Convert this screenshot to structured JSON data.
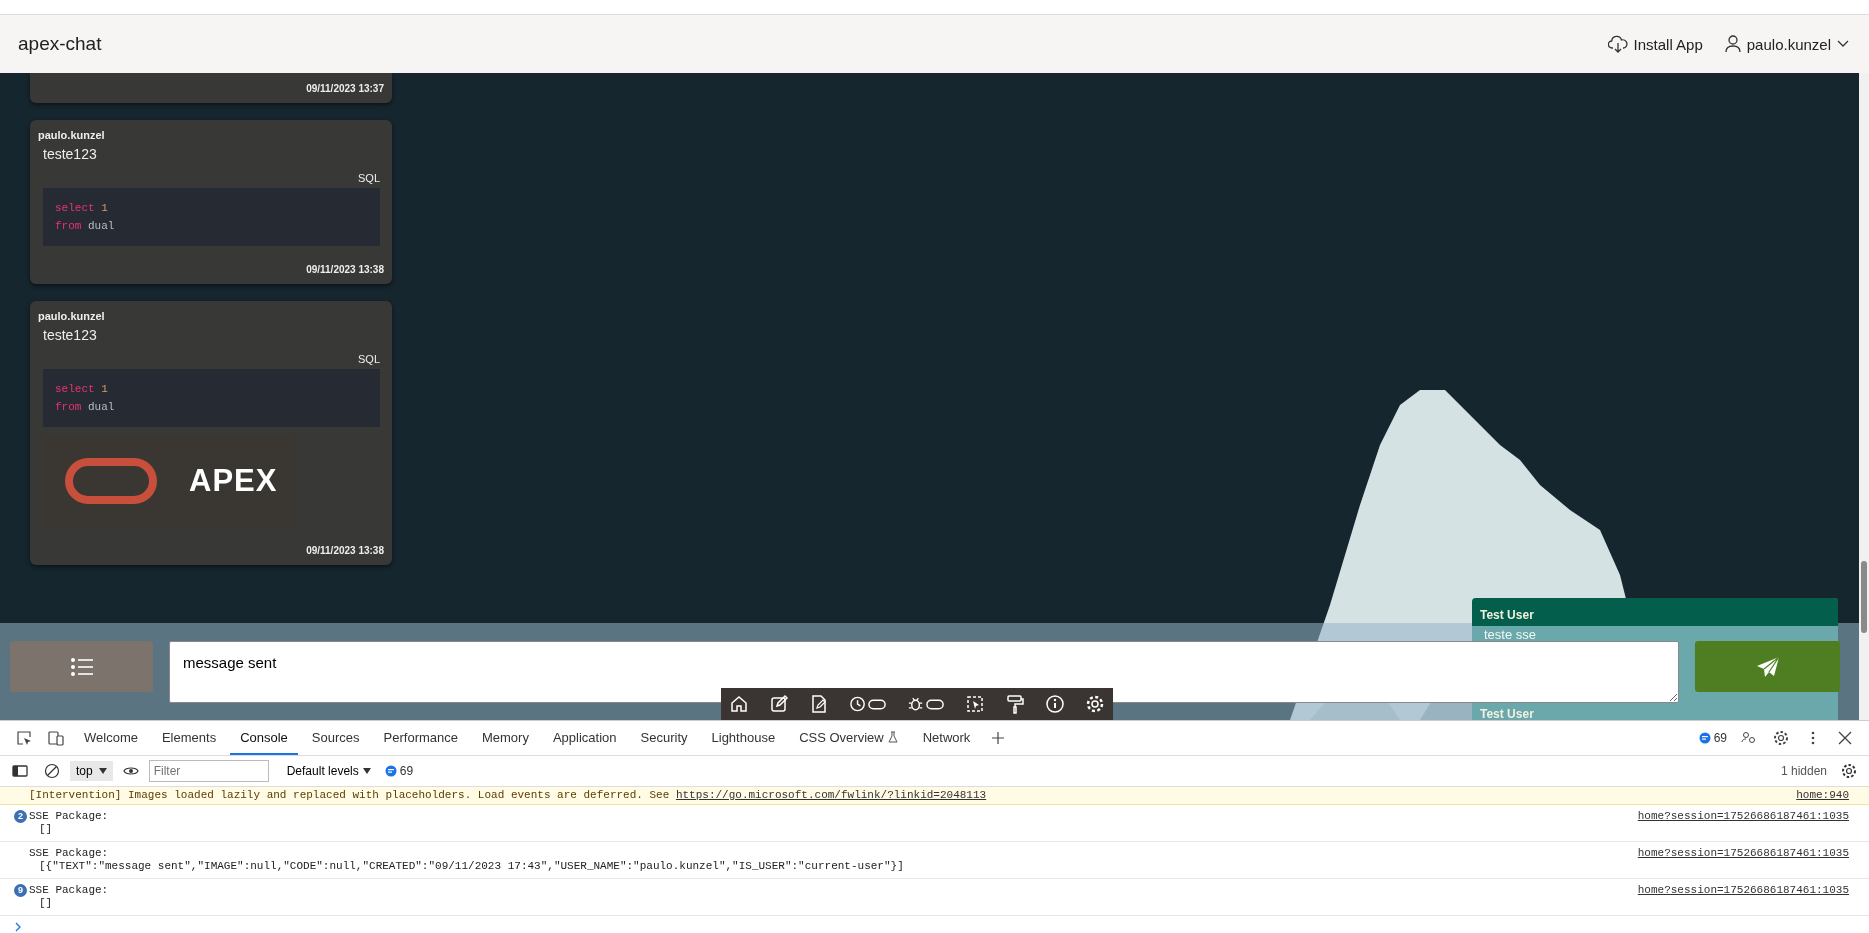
{
  "header": {
    "title": "apex-chat",
    "install_label": "Install App",
    "user": "paulo.kunzel"
  },
  "messages": [
    {
      "created": "09/11/2023 13:37"
    },
    {
      "user": "paulo.kunzel",
      "text": "teste123",
      "code": {
        "language": "SQL",
        "lines": [
          [
            {
              "kind": "keyword",
              "text": "select"
            },
            {
              "kind": "number",
              "text": "1"
            }
          ],
          [
            {
              "kind": "keyword",
              "text": "from"
            },
            {
              "kind": "plain",
              "text": "dual"
            }
          ]
        ]
      },
      "created": "09/11/2023 13:38"
    },
    {
      "user": "paulo.kunzel",
      "text": "teste123",
      "code": {
        "language": "SQL",
        "lines": [
          [
            {
              "kind": "keyword",
              "text": "select"
            },
            {
              "kind": "number",
              "text": "1"
            }
          ],
          [
            {
              "kind": "keyword",
              "text": "from"
            },
            {
              "kind": "plain",
              "text": "dual"
            }
          ]
        ]
      },
      "image": {
        "kind": "logo",
        "text": "APEX"
      },
      "created": "09/11/2023 13:38"
    }
  ],
  "incoming": [
    {
      "user": "Test User",
      "text": "teste sse"
    },
    {
      "user": "Test User"
    }
  ],
  "composer": {
    "value": "message sent"
  },
  "devtools": {
    "tabs": [
      {
        "label": "Welcome",
        "selected": false
      },
      {
        "label": "Elements",
        "selected": false
      },
      {
        "label": "Console",
        "selected": true
      },
      {
        "label": "Sources",
        "selected": false
      },
      {
        "label": "Performance",
        "selected": false
      },
      {
        "label": "Memory",
        "selected": false
      },
      {
        "label": "Application",
        "selected": false
      },
      {
        "label": "Security",
        "selected": false
      },
      {
        "label": "Lighthouse",
        "selected": false
      },
      {
        "label": "CSS Overview",
        "selected": false,
        "experimental": true
      },
      {
        "label": "Network",
        "selected": false
      }
    ],
    "issues_count": "69",
    "context": "top",
    "filter_placeholder": "Filter",
    "levels": "Default levels",
    "message_count": "69",
    "hidden": "1 hidden",
    "console": [
      {
        "kind": "warning",
        "text": "[Intervention] Images loaded lazily and replaced with placeholders. Load events are deferred. See ",
        "link": "https://go.microsoft.com/fwlink/?linkid=2048113",
        "source": "home:940"
      },
      {
        "kind": "log",
        "count": "2",
        "lines": [
          "SSE Package:",
          "[]"
        ],
        "source": "home?session=17526686187461:1035"
      },
      {
        "kind": "log",
        "lines": [
          "SSE Package:",
          "[{\"TEXT\":\"message sent\",\"IMAGE\":null,\"CODE\":null,\"CREATED\":\"09/11/2023 17:43\",\"USER_NAME\":\"paulo.kunzel\",\"IS_USER\":\"current-user\"}]"
        ],
        "source": "home?session=17526686187461:1035"
      },
      {
        "kind": "log",
        "count": "9",
        "lines": [
          "SSE Package:",
          "[]"
        ],
        "source": "home?session=17526686187461:1035"
      }
    ]
  }
}
